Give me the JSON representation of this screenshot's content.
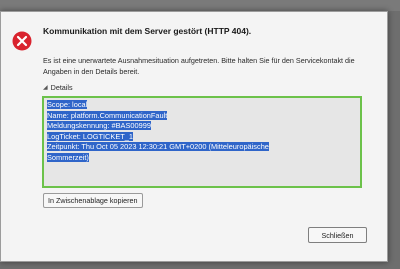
{
  "dialog": {
    "title": "Kommunikation mit dem Server gestört (HTTP 404).",
    "message": "Es ist eine unerwartete Ausnahmesituation aufgetreten. Bitte halten Sie für den Servicekontakt die Angaben in den Details bereit.",
    "details_label": "Details",
    "details_lines": [
      "Scope: local",
      "Name: platform.CommunicationFault",
      "Meldungskennung: #BAS00999",
      "LogTicket: LOGTICKET_1",
      "Zeitpunkt: Thu Oct 05 2023 12:30:21 GMT+0200 (Mitteleuropäische",
      "Sommerzeit)"
    ],
    "copy_button": "In Zwischenablage kopieren",
    "close_button": "Schließen",
    "icon": "error-icon",
    "colors": {
      "error_red": "#d9232e",
      "selection": "#2f65c9",
      "focus_border": "#6cc24a"
    }
  }
}
